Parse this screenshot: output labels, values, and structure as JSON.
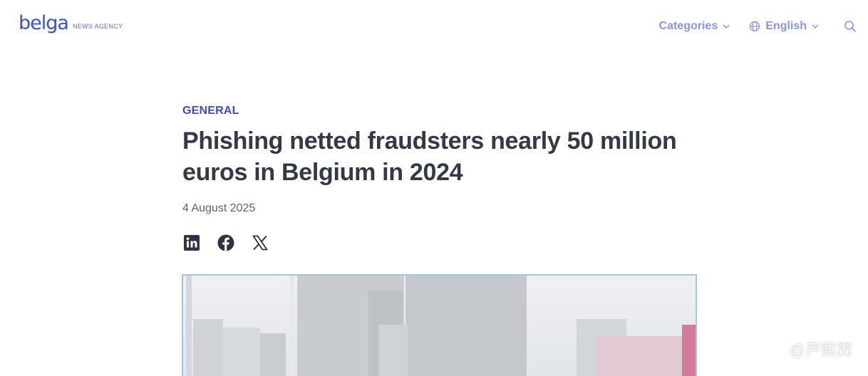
{
  "header": {
    "logo_text": "belga",
    "logo_sub": "NEWS AGENCY",
    "categories_label": "Categories",
    "language_label": "English",
    "search_icon": "search-icon"
  },
  "article": {
    "category": "GENERAL",
    "title": "Phishing netted fraudsters nearly 50 million euros in Belgium in 2024",
    "date": "4 August 2025",
    "share": [
      "linkedin-icon",
      "facebook-icon",
      "x-icon"
    ]
  },
  "watermark": {
    "text": "@芦熙霖"
  },
  "colors": {
    "brand": "#3d4fd1",
    "nav": "#8a94e6",
    "category": "#3f4bc4",
    "title": "#333a45",
    "image_border": "#9cc6e2"
  }
}
